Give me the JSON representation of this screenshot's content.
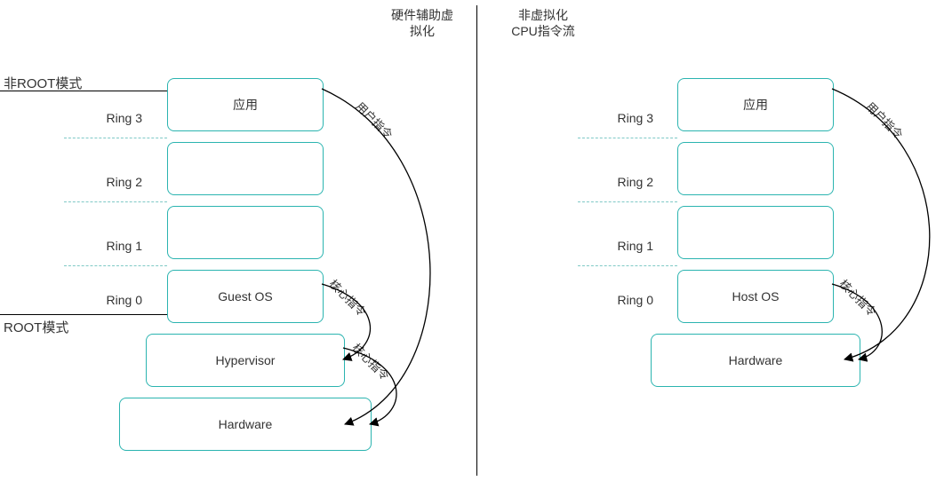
{
  "left": {
    "title": "硬件辅助虚\n拟化",
    "mode_nonroot": "非ROOT模式",
    "mode_root": "ROOT模式",
    "rings": [
      "Ring 3",
      "Ring 2",
      "Ring 1",
      "Ring 0"
    ],
    "boxes": {
      "app": "应用",
      "ring2": "",
      "ring1": "",
      "guest": "Guest OS",
      "hyper": "Hypervisor",
      "hw": "Hardware"
    },
    "arcs": {
      "user": "用户指令",
      "kernel1": "核心指令",
      "kernel2": "核心指令"
    }
  },
  "right": {
    "title": "非虚拟化\nCPU指令流",
    "rings": [
      "Ring 3",
      "Ring 2",
      "Ring 1",
      "Ring 0"
    ],
    "boxes": {
      "app": "应用",
      "ring2": "",
      "ring1": "",
      "host": "Host OS",
      "hw": "Hardware"
    },
    "arcs": {
      "user": "用户指令",
      "kernel": "核心指令"
    }
  },
  "colors": {
    "box_border": "#2bb4b0",
    "line": "#000",
    "dash": "#7fc9c6"
  }
}
